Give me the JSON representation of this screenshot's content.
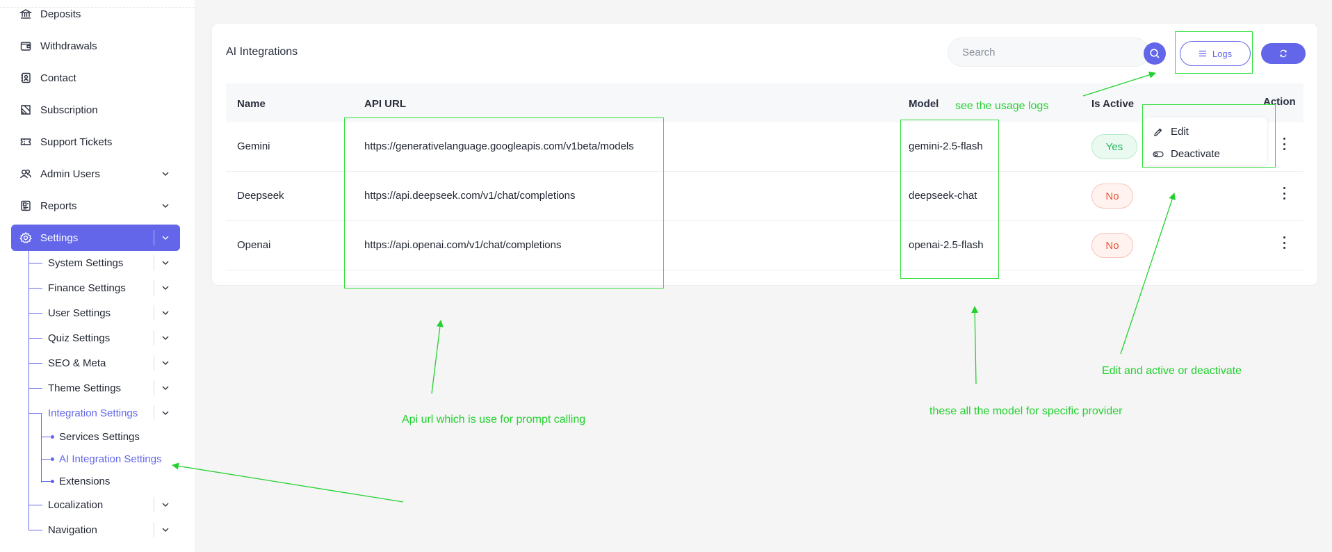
{
  "sidebar": {
    "items": [
      {
        "label": "Deposits",
        "icon": "bank-icon"
      },
      {
        "label": "Withdrawals",
        "icon": "wallet-icon"
      },
      {
        "label": "Contact",
        "icon": "contact-book-icon"
      },
      {
        "label": "Subscription",
        "icon": "ticket-icon"
      },
      {
        "label": "Support Tickets",
        "icon": "support-ticket-icon"
      },
      {
        "label": "Admin Users",
        "icon": "users-icon"
      },
      {
        "label": "Reports",
        "icon": "report-icon"
      },
      {
        "label": "Settings",
        "icon": "gear-icon"
      }
    ],
    "settings_children": [
      {
        "label": "System Settings"
      },
      {
        "label": "Finance Settings"
      },
      {
        "label": "User Settings"
      },
      {
        "label": "Quiz Settings"
      },
      {
        "label": "SEO & Meta"
      },
      {
        "label": "Theme Settings"
      },
      {
        "label": "Integration Settings"
      },
      {
        "label": "Localization"
      },
      {
        "label": "Navigation"
      }
    ],
    "integration_children": [
      {
        "label": "Services Settings"
      },
      {
        "label": "AI Integration Settings"
      },
      {
        "label": "Extensions"
      }
    ]
  },
  "card": {
    "title": "AI Integrations",
    "search_placeholder": "Search",
    "logs_label": "Logs"
  },
  "table": {
    "headers": {
      "name": "Name",
      "api_url": "API URL",
      "model": "Model",
      "is_active": "Is Active",
      "action": "Action"
    },
    "rows": [
      {
        "name": "Gemini",
        "api_url": "https://generativelanguage.googleapis.com/v1beta/models",
        "model": "gemini-2.5-flash",
        "active": "Yes"
      },
      {
        "name": "Deepseek",
        "api_url": "https://api.deepseek.com/v1/chat/completions",
        "model": "deepseek-chat",
        "active": "No"
      },
      {
        "name": "Openai",
        "api_url": "https://api.openai.com/v1/chat/completions",
        "model": "openai-2.5-flash",
        "active": "No"
      }
    ]
  },
  "action_menu": {
    "edit": "Edit",
    "deactivate": "Deactivate"
  },
  "annotations": {
    "logs": "see the usage logs",
    "api_url": "Api url which is use for prompt calling",
    "model": "these all the model for specific provider",
    "action": "Edit and active or deactivate"
  },
  "colors": {
    "accent": "#6366e8",
    "annotation": "#22d12f",
    "yes_badge": "#22b35a",
    "no_badge": "#e8573b"
  }
}
